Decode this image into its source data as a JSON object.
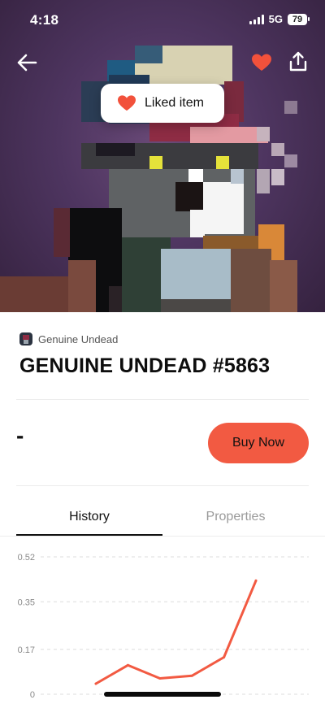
{
  "status_bar": {
    "time": "4:18",
    "network": "5G",
    "battery": "79"
  },
  "toast": {
    "label": "Liked item",
    "icon": "heart-icon"
  },
  "nav": {
    "back_icon": "arrow-left-icon",
    "like_icon": "heart-icon",
    "share_icon": "share-icon"
  },
  "collection": {
    "name": "Genuine Undead"
  },
  "item": {
    "title": "GENUINE UNDEAD #5863",
    "price": "-"
  },
  "actions": {
    "buy_label": "Buy Now"
  },
  "tabs": [
    {
      "label": "History",
      "active": true
    },
    {
      "label": "Properties",
      "active": false
    }
  ],
  "colors": {
    "accent": "#f25a42",
    "like": "#f2513b",
    "text": "#111111",
    "muted": "#9a9a9a"
  },
  "chart_data": {
    "type": "line",
    "title": "",
    "xlabel": "",
    "ylabel": "",
    "y_ticks": [
      "0.52",
      "0.35",
      "0.17",
      "0"
    ],
    "ylim": [
      0,
      0.52
    ],
    "grid": true,
    "series": [
      {
        "values": [
          0.04,
          0.11,
          0.06,
          0.07,
          0.14,
          0.43
        ]
      }
    ]
  }
}
